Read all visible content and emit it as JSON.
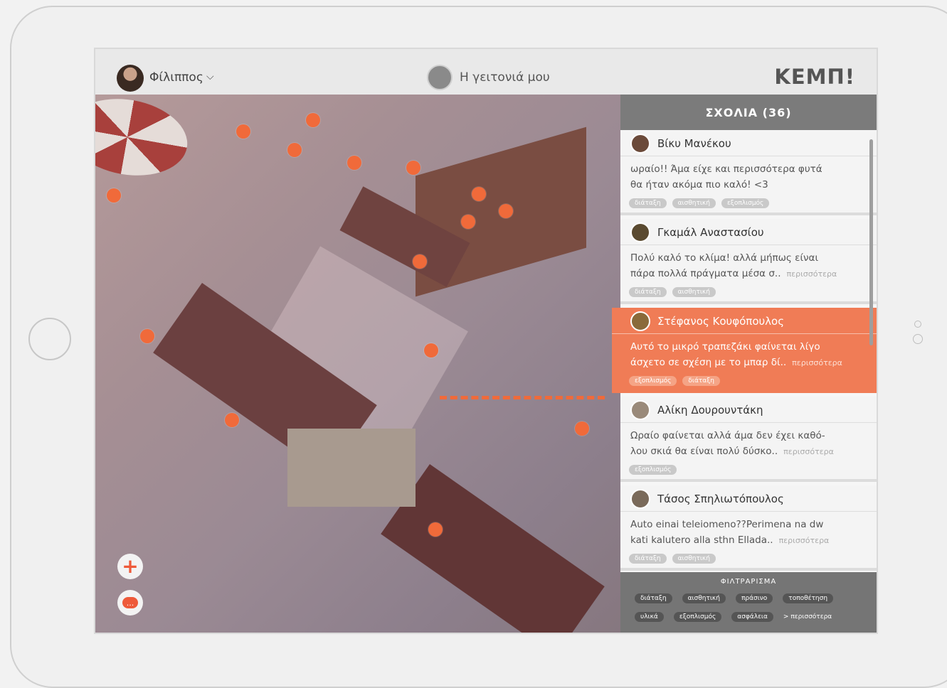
{
  "header": {
    "user_name": "Φίλιππος",
    "neighborhood_label": "Η γειτονιά μου",
    "brand": "ΚΕΜΠ!"
  },
  "comments_panel": {
    "title": "ΣΧΟΛΙΑ (36)",
    "more_label": "περισσότερα",
    "comments": [
      {
        "author": "Βίκυ Μανέκου",
        "text_lines": [
          "ωραίο!! Άμα είχε και περισσότερα φυτά",
          "θα ήταν ακόμα πιο καλό! <3"
        ],
        "tags": [
          "διάταξη",
          "αισθητική",
          "εξοπλισμός"
        ]
      },
      {
        "author": "Γκαμάλ Αναστασίου",
        "text_lines": [
          "Πολύ καλό το κλίμα! αλλά μήπως είναι",
          "πάρα πολλά πράγματα μέσα σ.."
        ],
        "tags": [
          "διάταξη",
          "αισθητική"
        ]
      },
      {
        "author": "Στέφανος Κουφόπουλος",
        "text_lines": [
          "Αυτό το μικρό τραπεζάκι φαίνεται λίγο",
          "άσχετο σε σχέση με το μπαρ δί.."
        ],
        "tags": [
          "εξοπλισμός",
          "διάταξη"
        ]
      },
      {
        "author": "Αλίκη Δουρουντάκη",
        "text_lines": [
          "Ωραίο φαίνεται αλλά άμα δεν έχει καθό-",
          "λου σκιά θα είναι πολύ δύσκο.."
        ],
        "tags": [
          "εξοπλισμός"
        ]
      },
      {
        "author": "Τάσος Σπηλιωτόπουλος",
        "text_lines": [
          "Auto einai teleiomeno??Perimena na dw",
          "kati kalutero alla sthn Ellada.."
        ],
        "tags": [
          "διάταξη",
          "αισθητική"
        ]
      }
    ]
  },
  "filter": {
    "title": "ΦΙΛΤΡΑΡΙΣΜΑ",
    "row1": [
      "διάταξη",
      "αισθητική",
      "πράσινο",
      "τοποθέτηση"
    ],
    "row2": [
      "υλικά",
      "εξοπλισμός",
      "ασφάλεια"
    ],
    "more": "> περισσότερα"
  },
  "map": {
    "add_label": "+",
    "comment_label": "...",
    "accent_color": "#f06a3a"
  }
}
